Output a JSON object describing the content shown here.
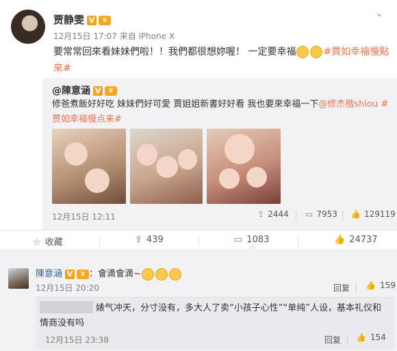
{
  "post": {
    "author": "贾静雯",
    "verified_badge": "V",
    "meta": "12月15日 17:07 来自 iPhone X",
    "text_before": "要常常回來看妹妹們啦！！我們都很想妳喔！ 一定要幸福",
    "hashtag": "#賈如幸福慢點來#"
  },
  "repost": {
    "author": "@陳意涵",
    "text_before": "修爸煮飯好好吃 妹妹們好可愛 賈姐姐新書好好看 我也要來幸福一下",
    "mention": "@修杰楷shiou",
    "hashtag": "#贾如幸福慢点来#",
    "date": "12月15日 12:11",
    "stats": {
      "repost": "2444",
      "comment": "7953",
      "like": "129119"
    }
  },
  "actions": {
    "favorite": "收藏",
    "repost": "439",
    "comment": "1083",
    "like": "24737"
  },
  "comments": [
    {
      "author": "陳意涵",
      "colon": "：",
      "text": "會滴會滴~",
      "date": "12月15日 20:20",
      "reply": "回复",
      "likes": "159"
    },
    {
      "text": "婊气冲天，分寸没有，多大人了卖“小孩子心性”“单纯”人设，基本礼仪和情商没有吗",
      "date": "12月15日 23:38",
      "reply": "回复",
      "likes": "154"
    }
  ],
  "colors": {
    "link": "#eb7350",
    "name": "#2c63a8",
    "repost_bg": "#f2f2f5"
  },
  "icons": [
    "chevron-down-icon",
    "repost-icon",
    "comment-icon",
    "like-icon",
    "star-icon"
  ]
}
